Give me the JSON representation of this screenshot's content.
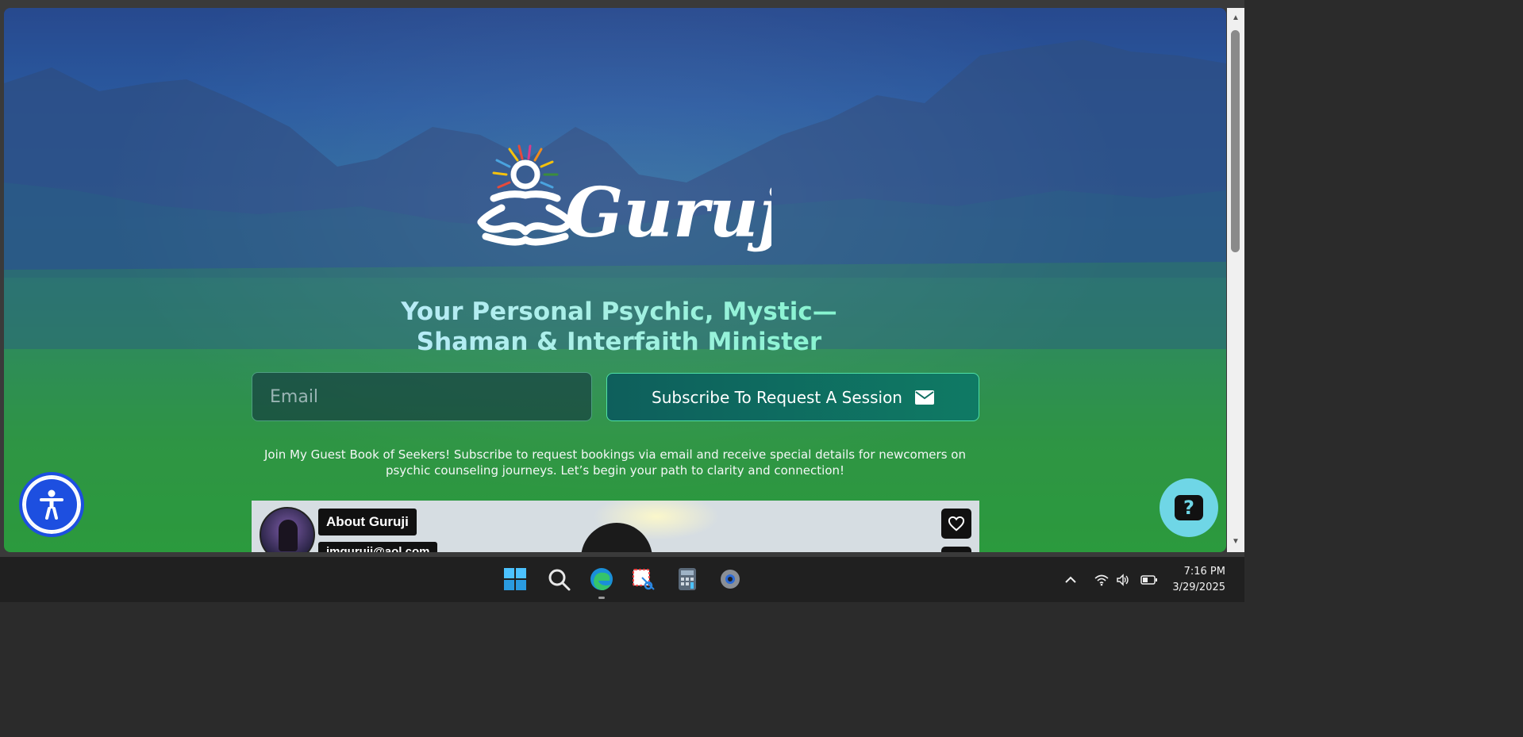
{
  "hero": {
    "headline_line1": "Your Personal Psychic, Mystic—",
    "headline_line2": "Shaman & Interfaith Minister",
    "logo_text": "Guruji"
  },
  "form": {
    "email_placeholder": "Email",
    "subscribe_label": "Subscribe To Request A Session"
  },
  "join_text": "Join My Guest Book of Seekers! Subscribe to request bookings via email and receive special details for newcomers on psychic counseling journeys. Let’s begin your path to clarity and connection!",
  "video": {
    "about_label": "About Guruji",
    "email_label": "jmguruji@aol.com"
  },
  "help": {
    "label": "?"
  },
  "colors": {
    "accent_green": "#4fe0a6",
    "accessibility_blue": "#1d4fe0",
    "help_cyan": "#6fd6e6"
  },
  "taskbar": {
    "icons": [
      "windows-start-icon",
      "search-icon",
      "edge-browser-icon",
      "snipping-tool-icon",
      "calculator-icon",
      "settings-gear-icon"
    ],
    "time": "7:16 PM",
    "date": "3/29/2025"
  }
}
